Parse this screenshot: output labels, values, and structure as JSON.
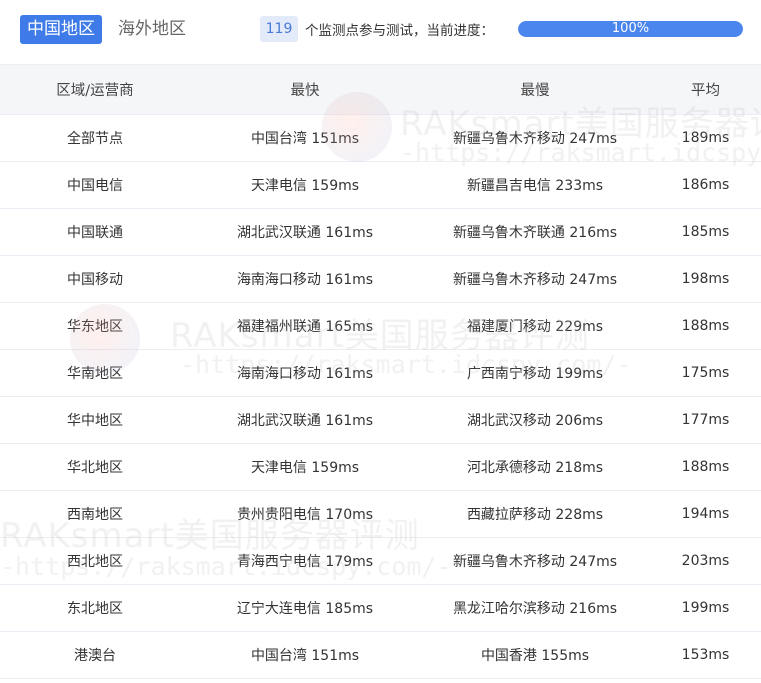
{
  "region_tabs": [
    {
      "label": "中国地区",
      "active": true
    },
    {
      "label": "海外地区",
      "active": false
    }
  ],
  "status": {
    "monitor_count": "119",
    "progress_text": "个监测点参与测试，当前进度：",
    "progress_value": "100%",
    "progress_fraction": 1.0
  },
  "table": {
    "columns": [
      "区域/运营商",
      "最快",
      "最慢",
      "平均"
    ],
    "rows": [
      [
        "全部节点",
        "中国台湾 151ms",
        "新疆乌鲁木齐移动 247ms",
        "189ms"
      ],
      [
        "中国电信",
        "天津电信 159ms",
        "新疆昌吉电信 233ms",
        "186ms"
      ],
      [
        "中国联通",
        "湖北武汉联通 161ms",
        "新疆乌鲁木齐联通 216ms",
        "185ms"
      ],
      [
        "中国移动",
        "海南海口移动 161ms",
        "新疆乌鲁木齐移动 247ms",
        "198ms"
      ],
      [
        "华东地区",
        "福建福州联通 165ms",
        "福建厦门移动 229ms",
        "188ms"
      ],
      [
        "华南地区",
        "海南海口移动 161ms",
        "广西南宁移动 199ms",
        "175ms"
      ],
      [
        "华中地区",
        "湖北武汉联通 161ms",
        "湖北武汉移动 206ms",
        "177ms"
      ],
      [
        "华北地区",
        "天津电信 159ms",
        "河北承德移动 218ms",
        "188ms"
      ],
      [
        "西南地区",
        "贵州贵阳电信 170ms",
        "西藏拉萨移动 228ms",
        "194ms"
      ],
      [
        "西北地区",
        "青海西宁电信 179ms",
        "新疆乌鲁木齐移动 247ms",
        "203ms"
      ],
      [
        "东北地区",
        "辽宁大连电信 185ms",
        "黑龙江哈尔滨移动 216ms",
        "199ms"
      ],
      [
        "港澳台",
        "中国台湾 151ms",
        "中国香港 155ms",
        "153ms"
      ]
    ]
  },
  "watermark": {
    "brand": "RAKsmart美国服务器评测",
    "url": "-https://raksmart.idcspy.com/-"
  },
  "colors": {
    "accent": "#3e7be8",
    "progress_fill": "#4a86ee",
    "badge_bg": "#e3ebfa",
    "header_bg": "#f5f6f8",
    "border": "#ebeef5"
  }
}
